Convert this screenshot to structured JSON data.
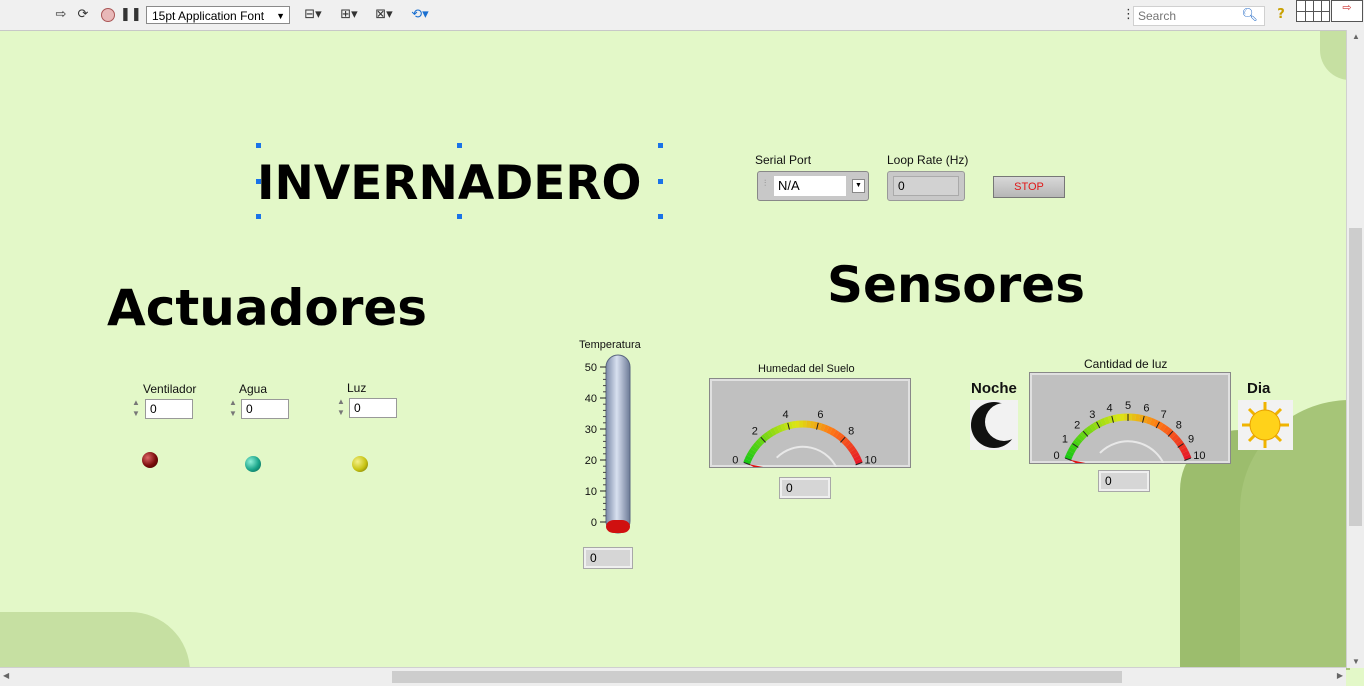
{
  "toolbar": {
    "font_select": "15pt Application Font",
    "search_placeholder": "Search"
  },
  "main_title": "INVERNADERO",
  "serial_port": {
    "label": "Serial Port",
    "value": "N/A"
  },
  "loop_rate": {
    "label": "Loop Rate (Hz)",
    "value": "0"
  },
  "stop_button": "STOP",
  "actuadores": {
    "title": "Actuadores",
    "controls": [
      {
        "label": "Ventilador",
        "value": "0",
        "led_color": "#7a0c0c"
      },
      {
        "label": "Agua",
        "value": "0",
        "led_color": "#1aa58a"
      },
      {
        "label": "Luz",
        "value": "0",
        "led_color": "#c8c414"
      }
    ]
  },
  "sensores": {
    "title": "Sensores"
  },
  "temperatura": {
    "label": "Temperatura",
    "ticks": [
      "50",
      "40",
      "30",
      "20",
      "10",
      "0"
    ],
    "value": "0",
    "level": 0
  },
  "humedad": {
    "label": "Humedad del Suelo",
    "ticks": [
      "0",
      "2",
      "4",
      "6",
      "8",
      "10"
    ],
    "value": "0",
    "level": 0
  },
  "luz_sensor": {
    "label": "Cantidad de luz",
    "ticks": [
      "0",
      "1",
      "2",
      "3",
      "4",
      "5",
      "6",
      "7",
      "8",
      "9",
      "10"
    ],
    "value": "0",
    "level": 0,
    "noche_label": "Noche",
    "dia_label": "Dia"
  }
}
